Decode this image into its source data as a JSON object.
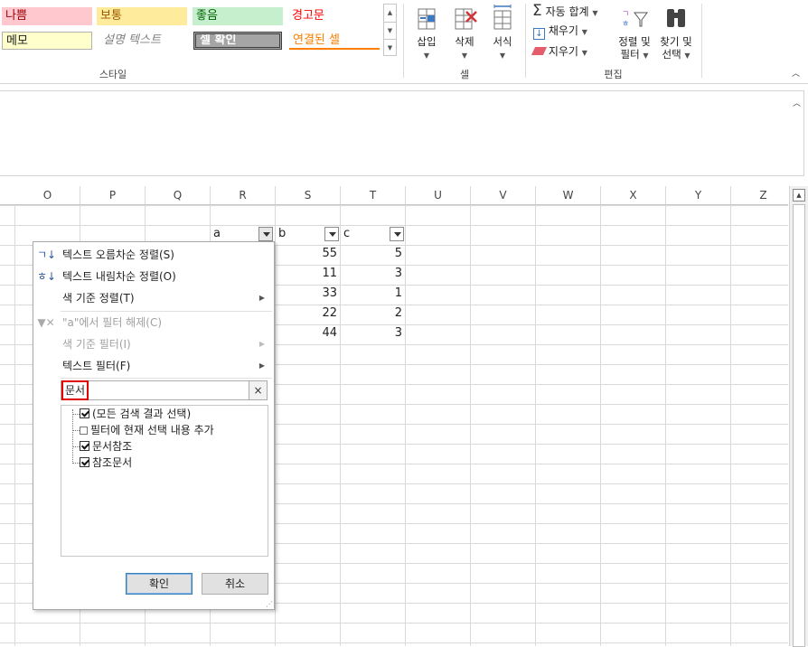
{
  "ribbon": {
    "cell_styles": {
      "bad": "나쁨",
      "neutral": "보통",
      "good": "좋음",
      "warning": "경고문",
      "note": "메모",
      "explanatory": "설명 텍스트",
      "check_cell": "셀 확인",
      "linked_cell": "연결된 셀",
      "group_label": "스타일"
    },
    "cells": {
      "insert": "삽입",
      "delete": "삭제",
      "format": "서식",
      "group_label": "셀"
    },
    "editing": {
      "autosum": "자동 합계",
      "fill": "채우기",
      "clear": "지우기",
      "sort_filter_line1": "정렬 및",
      "sort_filter_line2": "필터",
      "find_select_line1": "찾기 및",
      "find_select_line2": "선택",
      "group_label": "편집"
    },
    "colors": {
      "bad_bg": "#ffc7ce",
      "bad_fg": "#9c0006",
      "neutral_bg": "#ffeb9c",
      "neutral_fg": "#9c5700",
      "good_bg": "#c6efce",
      "good_fg": "#006100",
      "warning_fg": "#ff0000",
      "note_bg": "#ffffcc",
      "check_bg": "#a5a5a5",
      "linked_fg": "#fa7d00"
    }
  },
  "columns": [
    "O",
    "P",
    "Q",
    "R",
    "S",
    "T",
    "U",
    "V",
    "W",
    "X",
    "Y",
    "Z"
  ],
  "table": {
    "headers": [
      "a",
      "b",
      "c"
    ],
    "rows": [
      [
        "",
        "55",
        "5"
      ],
      [
        "",
        "11",
        "3"
      ],
      [
        "",
        "33",
        "1"
      ],
      [
        "",
        "22",
        "2"
      ],
      [
        "",
        "44",
        "3"
      ]
    ]
  },
  "filter_menu": {
    "sort_asc": "텍스트 오름차순 정렬(S)",
    "sort_desc": "텍스트 내림차순 정렬(O)",
    "sort_by_color": "색 기준 정렬(T)",
    "clear_filter": "\"a\"에서 필터 해제(C)",
    "filter_by_color": "색 기준 필터(I)",
    "text_filters": "텍스트 필터(F)",
    "search_value": "문서",
    "search_clear_icon": "×",
    "items": [
      {
        "label": "(모든 검색 결과 선택)",
        "checked": true
      },
      {
        "label": "필터에 현재 선택 내용 추가",
        "checked": false
      },
      {
        "label": "문서참조",
        "checked": true
      },
      {
        "label": "참조문서",
        "checked": true
      }
    ],
    "ok": "확인",
    "cancel": "취소"
  },
  "icons": {
    "sort_asc": "sort-asc-icon",
    "sort_desc": "sort-desc-icon",
    "clear_filter": "clear-filter-icon",
    "autosum_glyph": "Σ"
  }
}
